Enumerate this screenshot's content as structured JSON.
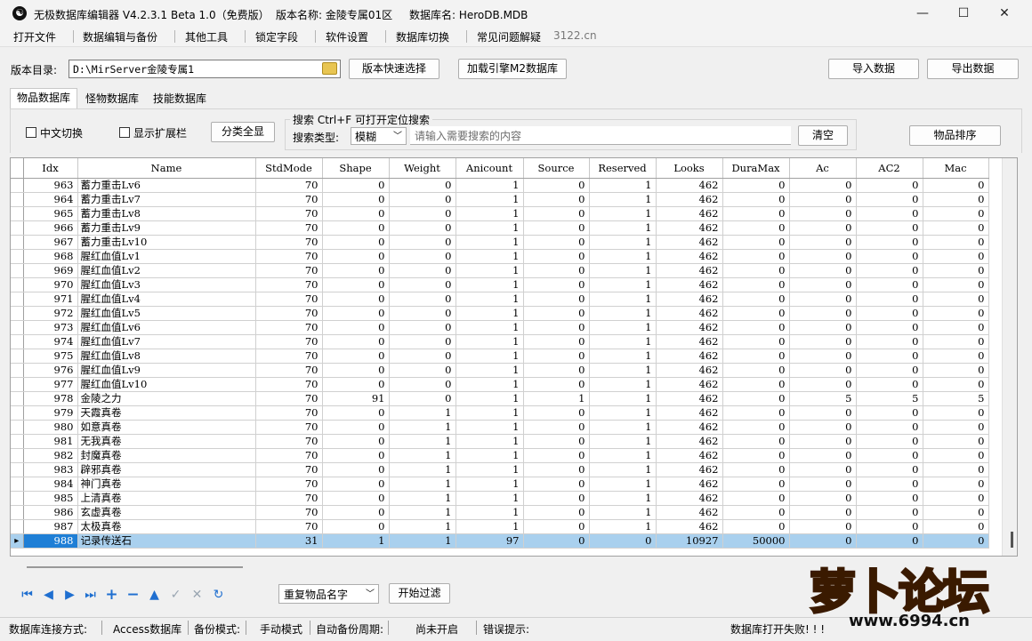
{
  "window": {
    "app_title": "无极数据库编辑器 V4.2.3.1",
    "beta": "Beta 1.0（免费版）",
    "version_name": "版本名称: 金陵专属01区",
    "db_name": "数据库名: HeroDB.MDB",
    "minimize": "—",
    "maximize": "☐",
    "close": "✕"
  },
  "menu": [
    "打开文件",
    "数据编辑与备份",
    "其他工具",
    "锁定字段",
    "软件设置",
    "数据库切换",
    "常见问题解疑",
    "3122.cn"
  ],
  "toolbar": {
    "dir_label": "版本目录:",
    "dir_value": "D:\\MirServer金陵专属1",
    "quick_select": "版本快速选择",
    "load_engine": "加载引擎M2数据库",
    "import": "导入数据",
    "export": "导出数据"
  },
  "tabs": [
    "物品数据库",
    "怪物数据库",
    "技能数据库"
  ],
  "filters": {
    "chinese_switch": "中文切换",
    "show_ext": "显示扩展栏",
    "show_all": "分类全显",
    "search_title": "搜索  Ctrl+F 可打开定位搜索",
    "search_type_label": "搜索类型:",
    "search_type_value": "模糊",
    "search_placeholder": "请输入需要搜索的内容",
    "clear": "清空",
    "sort": "物品排序"
  },
  "columns": [
    "Idx",
    "Name",
    "StdMode",
    "Shape",
    "Weight",
    "Anicount",
    "Source",
    "Reserved",
    "Looks",
    "DuraMax",
    "Ac",
    "AC2",
    "Mac"
  ],
  "rows": [
    [
      "963",
      "蓄力重击Lv6",
      "70",
      "0",
      "0",
      "1",
      "0",
      "1",
      "462",
      "0",
      "0",
      "0",
      "0"
    ],
    [
      "964",
      "蓄力重击Lv7",
      "70",
      "0",
      "0",
      "1",
      "0",
      "1",
      "462",
      "0",
      "0",
      "0",
      "0"
    ],
    [
      "965",
      "蓄力重击Lv8",
      "70",
      "0",
      "0",
      "1",
      "0",
      "1",
      "462",
      "0",
      "0",
      "0",
      "0"
    ],
    [
      "966",
      "蓄力重击Lv9",
      "70",
      "0",
      "0",
      "1",
      "0",
      "1",
      "462",
      "0",
      "0",
      "0",
      "0"
    ],
    [
      "967",
      "蓄力重击Lv10",
      "70",
      "0",
      "0",
      "1",
      "0",
      "1",
      "462",
      "0",
      "0",
      "0",
      "0"
    ],
    [
      "968",
      "腥红血值Lv1",
      "70",
      "0",
      "0",
      "1",
      "0",
      "1",
      "462",
      "0",
      "0",
      "0",
      "0"
    ],
    [
      "969",
      "腥红血值Lv2",
      "70",
      "0",
      "0",
      "1",
      "0",
      "1",
      "462",
      "0",
      "0",
      "0",
      "0"
    ],
    [
      "970",
      "腥红血值Lv3",
      "70",
      "0",
      "0",
      "1",
      "0",
      "1",
      "462",
      "0",
      "0",
      "0",
      "0"
    ],
    [
      "971",
      "腥红血值Lv4",
      "70",
      "0",
      "0",
      "1",
      "0",
      "1",
      "462",
      "0",
      "0",
      "0",
      "0"
    ],
    [
      "972",
      "腥红血值Lv5",
      "70",
      "0",
      "0",
      "1",
      "0",
      "1",
      "462",
      "0",
      "0",
      "0",
      "0"
    ],
    [
      "973",
      "腥红血值Lv6",
      "70",
      "0",
      "0",
      "1",
      "0",
      "1",
      "462",
      "0",
      "0",
      "0",
      "0"
    ],
    [
      "974",
      "腥红血值Lv7",
      "70",
      "0",
      "0",
      "1",
      "0",
      "1",
      "462",
      "0",
      "0",
      "0",
      "0"
    ],
    [
      "975",
      "腥红血值Lv8",
      "70",
      "0",
      "0",
      "1",
      "0",
      "1",
      "462",
      "0",
      "0",
      "0",
      "0"
    ],
    [
      "976",
      "腥红血值Lv9",
      "70",
      "0",
      "0",
      "1",
      "0",
      "1",
      "462",
      "0",
      "0",
      "0",
      "0"
    ],
    [
      "977",
      "腥红血值Lv10",
      "70",
      "0",
      "0",
      "1",
      "0",
      "1",
      "462",
      "0",
      "0",
      "0",
      "0"
    ],
    [
      "978",
      "金陵之力",
      "70",
      "91",
      "0",
      "1",
      "1",
      "1",
      "462",
      "0",
      "5",
      "5",
      "5"
    ],
    [
      "979",
      "天霞真卷",
      "70",
      "0",
      "1",
      "1",
      "0",
      "1",
      "462",
      "0",
      "0",
      "0",
      "0"
    ],
    [
      "980",
      "如意真卷",
      "70",
      "0",
      "1",
      "1",
      "0",
      "1",
      "462",
      "0",
      "0",
      "0",
      "0"
    ],
    [
      "981",
      "无我真卷",
      "70",
      "0",
      "1",
      "1",
      "0",
      "1",
      "462",
      "0",
      "0",
      "0",
      "0"
    ],
    [
      "982",
      "封魔真卷",
      "70",
      "0",
      "1",
      "1",
      "0",
      "1",
      "462",
      "0",
      "0",
      "0",
      "0"
    ],
    [
      "983",
      "辟邪真卷",
      "70",
      "0",
      "1",
      "1",
      "0",
      "1",
      "462",
      "0",
      "0",
      "0",
      "0"
    ],
    [
      "984",
      "神门真卷",
      "70",
      "0",
      "1",
      "1",
      "0",
      "1",
      "462",
      "0",
      "0",
      "0",
      "0"
    ],
    [
      "985",
      "上清真卷",
      "70",
      "0",
      "1",
      "1",
      "0",
      "1",
      "462",
      "0",
      "0",
      "0",
      "0"
    ],
    [
      "986",
      "玄虚真卷",
      "70",
      "0",
      "1",
      "1",
      "0",
      "1",
      "462",
      "0",
      "0",
      "0",
      "0"
    ],
    [
      "987",
      "太极真卷",
      "70",
      "0",
      "1",
      "1",
      "0",
      "1",
      "462",
      "0",
      "0",
      "0",
      "0"
    ],
    [
      "988",
      "记录传送石",
      "31",
      "1",
      "1",
      "97",
      "0",
      "0",
      "10927",
      "50000",
      "0",
      "0",
      "0"
    ]
  ],
  "selected_idx": "988",
  "bottom": {
    "dup_select": "重复物品名字",
    "start_filter": "开始过滤"
  },
  "nav_icons": [
    "first-icon",
    "prior-icon",
    "next-icon",
    "last-icon",
    "insert-icon",
    "delete-icon",
    "edit-icon",
    "post-icon",
    "cancel-icon",
    "refresh-icon"
  ],
  "status": {
    "conn_label": "数据库连接方式:",
    "conn_value": "Access数据库",
    "backup_label": "备份模式:",
    "backup_value": "手动模式",
    "auto_label": "自动备份周期:",
    "auto_value": "尚未开启",
    "err_label": "错误提示:",
    "err_value": "数据库打开失败! ! !"
  },
  "watermark": {
    "brand": "萝卜论坛",
    "url": "www.6994.cn"
  },
  "colors": {
    "selected_row": "#a9d0ee",
    "selected_idx": "#1f7fd6",
    "nav_blue": "#1f6fd0",
    "logo_orange": "#f08a1c"
  }
}
